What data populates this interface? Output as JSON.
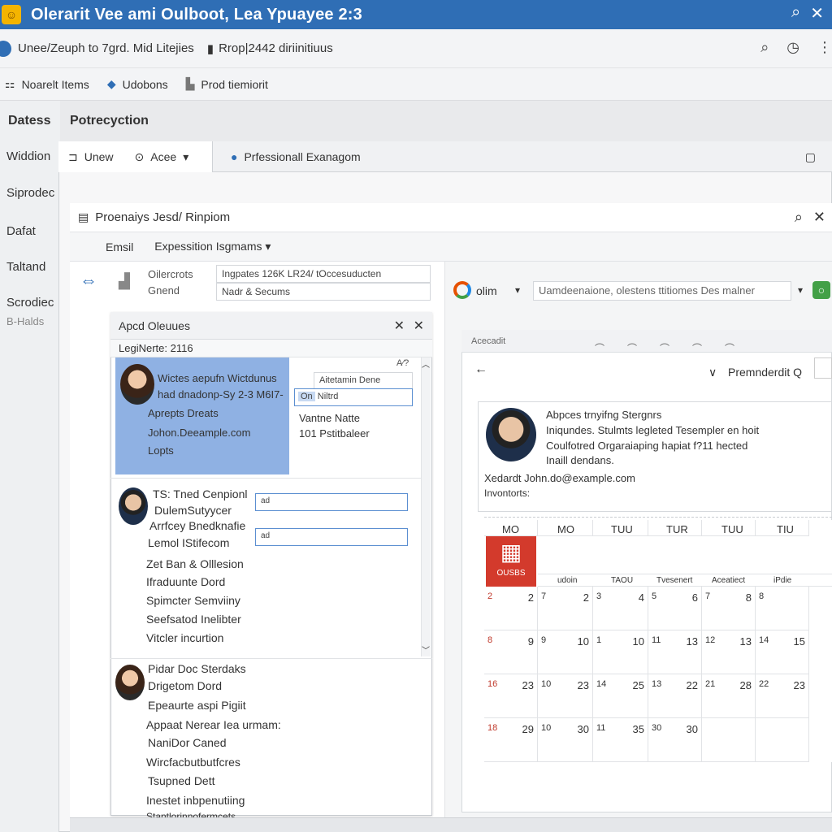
{
  "window": {
    "title": "Olerarit Vee ami Oulboot, Lea Ypuayee 2:3",
    "icons": [
      "search-icon",
      "close-icon"
    ]
  },
  "toolbar1": {
    "breadcrumb": "Unee/Zeuph to 7grd. Mid Litejies",
    "project": "Rrop|2442 diriinitiuus"
  },
  "toolbar2": {
    "items": [
      {
        "label": "Noarelt Items",
        "icon": "grid-icon"
      },
      {
        "label": "Udobons",
        "icon": "cube-icon"
      },
      {
        "label": "Prod tiemiorit",
        "icon": "person-icon"
      }
    ]
  },
  "sidebar": {
    "header1": "Datess",
    "header2": "Potrecyction",
    "items": [
      "Widdion",
      "Siprodec",
      "Dafat",
      "Taltand",
      "Scrodiec",
      "B-Halds"
    ]
  },
  "window1": {
    "tabs": [
      {
        "label": "Unew",
        "icon": "new-icon"
      },
      {
        "label": "Acee",
        "icon": "settings-icon"
      },
      {
        "label": "Prfessionall Exanagom",
        "icon": "person-icon"
      }
    ]
  },
  "window2": {
    "title": "Proenaiys  Jesd/ Rinpiom",
    "menu": [
      "Emsil",
      "Expessition Isgmams"
    ]
  },
  "left_fields": {
    "label1": "Oilercrots",
    "label2": "Gnend",
    "value1": "Ingpates 126K LR24/ tOccesuducten ",
    "value2": "Nadr & Secums"
  },
  "dialog": {
    "title": "Apcd Oleuues",
    "sub": "LegiNerte: 2116",
    "selected": {
      "line1": "Wictes aepufn Wictdunus",
      "line2": "had dnadonp-Sy 2-3 M6I7-",
      "line3": "Aprepts Dreats",
      "email": "Johon.Deeample.com",
      "line5": "Lopts"
    },
    "autocomplete": {
      "a": "Aitetamin Dene",
      "b": "Niltrd",
      "b_prefix": "On"
    },
    "side_note": {
      "line1": "Vantne Natte",
      "line2": "101 Pstitbaleer"
    },
    "contact2": {
      "lines": [
        "TS: Tned Cenpionl",
        "DulemSutyycer",
        "Arrfcey Bnedknafie",
        "Lemol IStifecom",
        "Zet Ban & Olllesion",
        "Ifraduunte Dord",
        "Spimcter Semviiny",
        "Seefsatod Inelibter",
        "Vitcler incurtion"
      ],
      "field": "ad"
    },
    "contact3": {
      "lines": [
        "Pidar Doc Sterdaks",
        "Drigetom Dord",
        "Epeaurte  aspi Pigiit",
        "Appaat Nerear Iea urmam:",
        "NaniDor Caned",
        "Wircfacbutbutfcres",
        "Tsupned Dett",
        "Inestet inbpenutiing",
        "Stantlorinnofermcets"
      ]
    }
  },
  "right": {
    "account_label": "olim",
    "search_placeholder": "Uamdeenaione, olestens ttitiomes Des malner",
    "subwindow_title": "Acecadit",
    "filter_label": "Premnderdit Q",
    "mail": {
      "line1": "Abpces trnyifng Stergnrs",
      "line2": "Iniqundes. Stulmts legleted Tesempler en hoit",
      "line3": "Coulfotred Orgaraiaping hapiat f?11 hected",
      "line4": "Inaill dendans.",
      "line5": "Xedardt John.do@example.com",
      "line6": "Invontorts:"
    },
    "calendar": {
      "headers": [
        "MO",
        "MO",
        "TUU",
        "TUR",
        "TUU",
        "TIU"
      ],
      "subheaders": [
        "udoin",
        "TAOU",
        "Tvesenert",
        "Aceatiect",
        "iPdie"
      ],
      "badge": "OUSBS",
      "rows": [
        [
          "2",
          "2",
          "7",
          "2",
          "3",
          "4",
          "5",
          "6",
          "7",
          "8",
          "8"
        ],
        [
          "8",
          "9",
          "9",
          "10",
          "1",
          "10",
          "11",
          "13",
          "12",
          "13",
          "14",
          "15"
        ],
        [
          "16",
          "23",
          "10",
          "23",
          "14",
          "25",
          "13",
          "22",
          "21",
          "28",
          "22",
          "23"
        ],
        [
          "18",
          "29",
          "10",
          "30",
          "11",
          "35",
          "30",
          "30"
        ]
      ]
    }
  },
  "colors": {
    "accent": "#2f6eb5",
    "selection": "#8fb1e3",
    "badge": "#d33a2c",
    "green": "#43a047"
  }
}
